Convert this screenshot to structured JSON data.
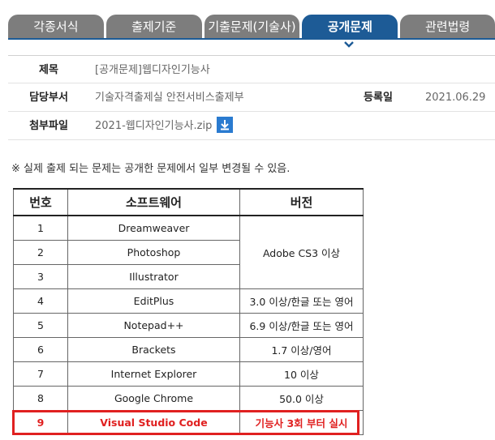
{
  "tabs": [
    {
      "label": "각종서식",
      "active": false
    },
    {
      "label": "출제기준",
      "active": false
    },
    {
      "label": "기출문제(기술사)",
      "active": false
    },
    {
      "label": "공개문제",
      "active": true
    },
    {
      "label": "관련법령",
      "active": false
    }
  ],
  "info": {
    "title_label": "제목",
    "title_value": "[공개문제]웹디자인기능사",
    "dept_label": "담당부서",
    "dept_value": "기술자격출제실 안전서비스출제부",
    "date_label": "등록일",
    "date_value": "2021.06.29",
    "file_label": "첨부파일",
    "file_value": "2021-웹디자인기능사.zip"
  },
  "notice": "※ 실제 출제 되는 문제는 공개한 문제에서 일부 변경될 수 있음.",
  "software_table": {
    "headers": [
      "번호",
      "소프트웨어",
      "버전"
    ],
    "rows": [
      {
        "no": "1",
        "software": "Dreamweaver"
      },
      {
        "no": "2",
        "software": "Photoshop",
        "version": "Adobe CS3 이상"
      },
      {
        "no": "3",
        "software": "Illustrator"
      },
      {
        "no": "4",
        "software": "EditPlus",
        "version": "3.0 이상/한글 또는 영어"
      },
      {
        "no": "5",
        "software": "Notepad++",
        "version": "6.9 이상/한글 또는 영어"
      },
      {
        "no": "6",
        "software": "Brackets",
        "version": "1.7 이상/영어"
      },
      {
        "no": "7",
        "software": "Internet Explorer",
        "version": "10 이상"
      },
      {
        "no": "8",
        "software": "Google Chrome",
        "version": "50.0 이상"
      },
      {
        "no": "9",
        "software": "Visual Studio Code",
        "version": "기능사 3회 부터 실시"
      }
    ]
  },
  "colors": {
    "tab_inactive": "#7d7d7d",
    "tab_active": "#1d5b96",
    "highlight": "#e02020",
    "download_icon": "#2a7bd0"
  },
  "icons": {
    "active_tab_marker": "chevron-down-icon",
    "attachment": "download-icon"
  }
}
